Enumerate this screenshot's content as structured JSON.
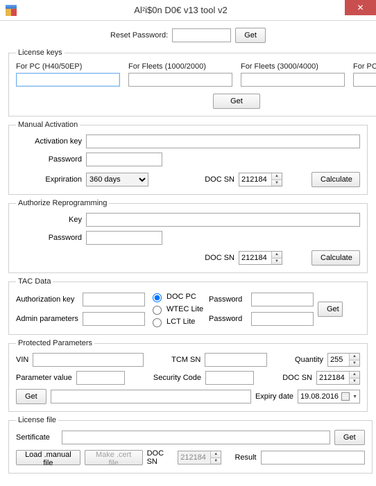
{
  "window": {
    "title": "Al²i$0n D0€ v13 tool v2"
  },
  "reset": {
    "label": "Reset Password:",
    "btn": "Get"
  },
  "license_keys": {
    "legend": "License keys",
    "cols": [
      "For PC (H40/50EP)",
      "For Fleets (1000/2000)",
      "For Fleets (3000/4000)",
      "For PC - Service Tool"
    ],
    "getbtn": "Get"
  },
  "manual": {
    "legend": "Manual Activation",
    "activation_key": "Activation key",
    "password": "Password",
    "expiration": "Expriration",
    "exp_value": "360 days",
    "doc_sn": "DOC SN",
    "doc_sn_val": "212184",
    "calc": "Calculate"
  },
  "auth": {
    "legend": "Authorize Reprogramming",
    "key": "Key",
    "password": "Password",
    "doc_sn": "DOC SN",
    "doc_sn_val": "212184",
    "calc": "Calculate"
  },
  "tac": {
    "legend": "TAC Data",
    "auth_key": "Authorization key",
    "admin_params": "Admin parameters",
    "radios": [
      "DOC PC",
      "WTEC Lite",
      "LCT Lite"
    ],
    "password": "Password",
    "getbtn": "Get"
  },
  "protected": {
    "legend": "Protected Parameters",
    "vin": "VIN",
    "tcm_sn": "TCM SN",
    "quantity": "Quantity",
    "quantity_val": "255",
    "param_value": "Parameter value",
    "security_code": "Security Code",
    "doc_sn": "DOC SN",
    "doc_sn_val": "212184",
    "getbtn": "Get",
    "expiry": "Expiry date",
    "expiry_val": "19.08.2016"
  },
  "licfile": {
    "legend": "License file",
    "cert": "Sertificate",
    "getbtn": "Get",
    "load": "Load .manual file",
    "make": "Make .cert file",
    "doc_sn": "DOC SN",
    "doc_sn_val": "212184",
    "result": "Result"
  }
}
